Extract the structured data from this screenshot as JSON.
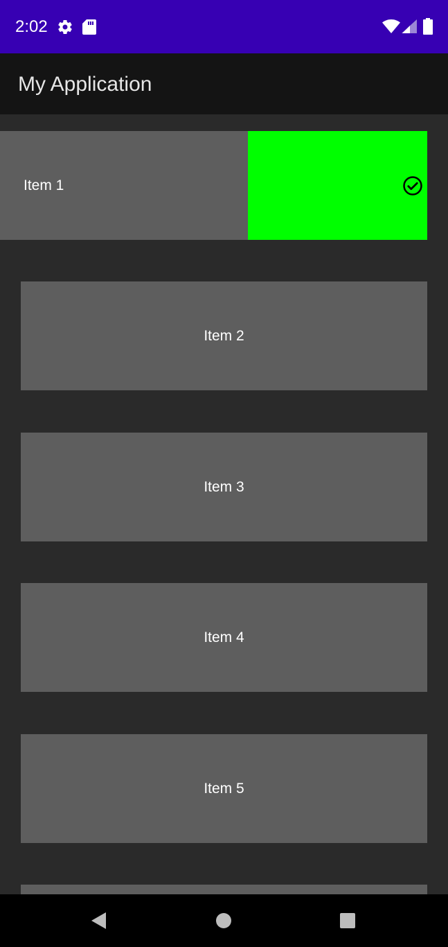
{
  "status_bar": {
    "time": "2:02",
    "background_color": "#3700b3",
    "left_icons": [
      "settings-gear-icon",
      "sd-card-icon"
    ],
    "right_icons": [
      "wifi-icon",
      "cellular-signal-icon",
      "battery-icon"
    ]
  },
  "app_bar": {
    "title": "My Application",
    "background_color": "#141414"
  },
  "list": {
    "items": [
      {
        "label": "Item 1",
        "state": "swiped",
        "action_icon": "check-circle-icon",
        "action_color": "#00ff00"
      },
      {
        "label": "Item 2"
      },
      {
        "label": "Item 3"
      },
      {
        "label": "Item 4"
      },
      {
        "label": "Item 5"
      },
      {
        "label": ""
      }
    ],
    "item_color": "#5e5e5e"
  },
  "nav_bar": {
    "buttons": [
      "back-icon",
      "home-icon",
      "recents-icon"
    ]
  }
}
